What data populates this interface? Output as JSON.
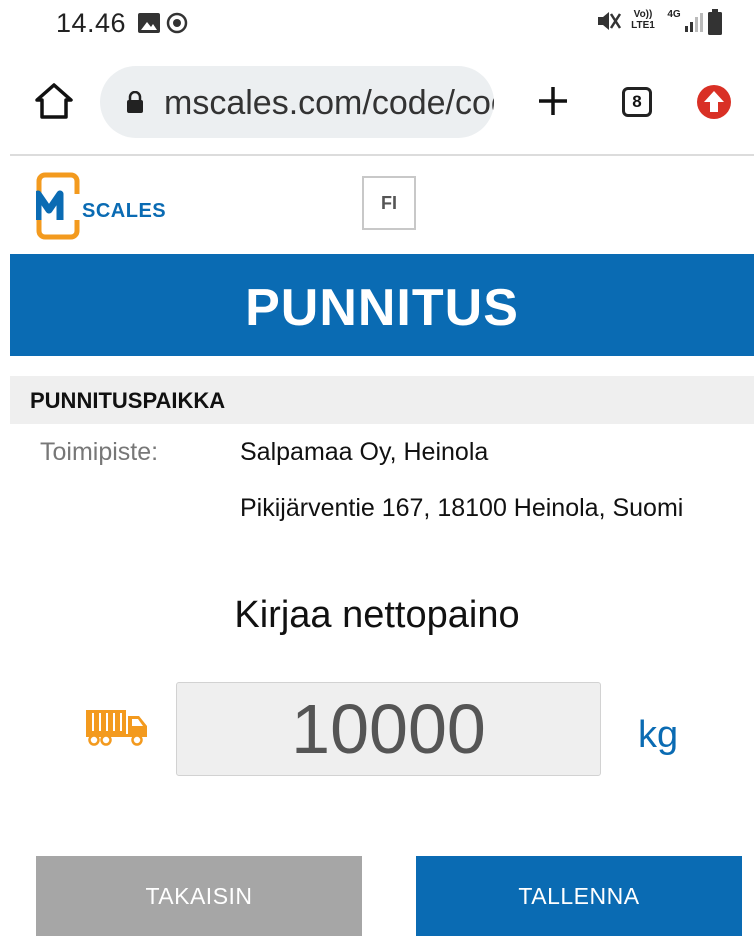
{
  "status_bar": {
    "time": "14.46",
    "network_volte": "Vo)) LTE1",
    "network_type": "4G"
  },
  "browser": {
    "url": "mscales.com/code/code",
    "tab_count": "8",
    "icons": [
      "home-icon",
      "lock-icon",
      "plus-icon",
      "tabs-counter",
      "update-icon"
    ]
  },
  "header": {
    "logo_text": "SCALES",
    "language": "FI"
  },
  "page": {
    "title": "PUNNITUS"
  },
  "location_section": {
    "heading": "PUNNITUSPAIKKA",
    "label": "Toimipiste:",
    "site_name": "Salpamaa Oy, Heinola",
    "address": "Pikijärventie 167, 18100 Heinola, Suomi"
  },
  "weight": {
    "prompt": "Kirjaa nettopaino",
    "value": "10000",
    "unit": "kg"
  },
  "buttons": {
    "back": "TAKAISIN",
    "save": "TALLENNA"
  },
  "colors": {
    "brand_blue": "#0a6bb3",
    "brand_orange": "#f39a1e",
    "button_grey": "#a6a6a6"
  }
}
